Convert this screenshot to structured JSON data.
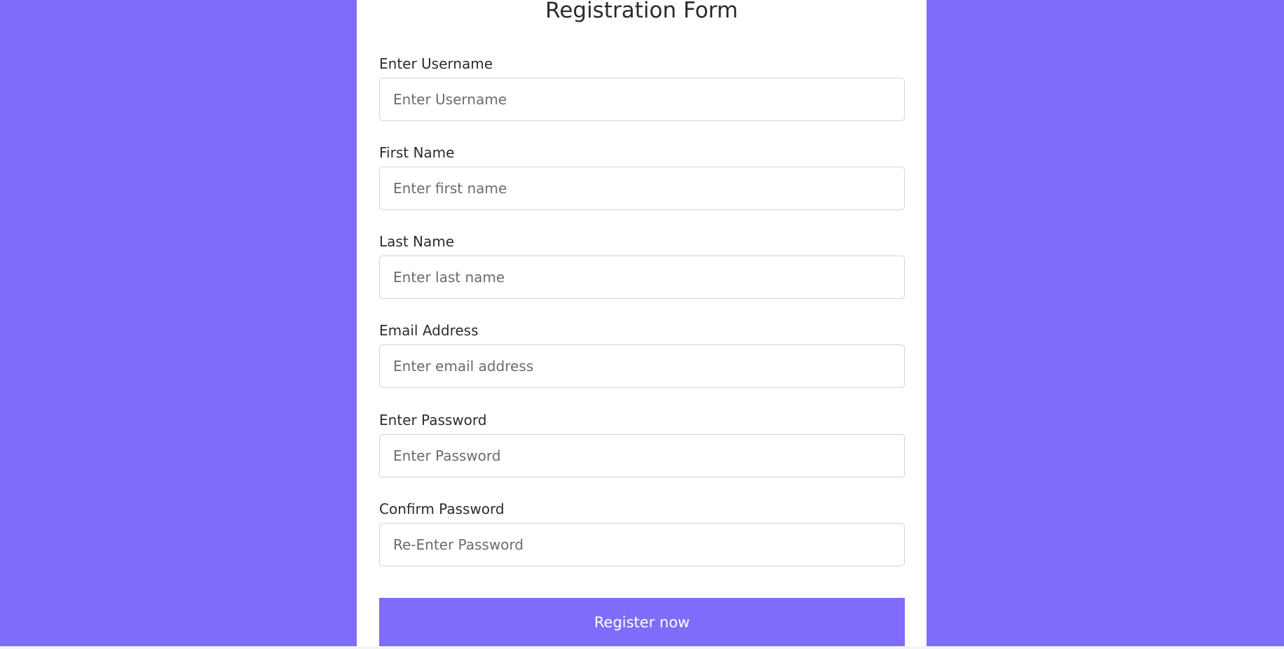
{
  "form": {
    "title": "Registration Form",
    "fields": [
      {
        "label": "Enter Username",
        "placeholder": "Enter Username",
        "value": ""
      },
      {
        "label": "First Name",
        "placeholder": "Enter first name",
        "value": ""
      },
      {
        "label": "Last Name",
        "placeholder": "Enter last name",
        "value": ""
      },
      {
        "label": "Email Address",
        "placeholder": "Enter email address",
        "value": ""
      },
      {
        "label": "Enter Password",
        "placeholder": "Enter Password",
        "value": ""
      },
      {
        "label": "Confirm Password",
        "placeholder": "Re-Enter Password",
        "value": ""
      }
    ],
    "submit_label": "Register now"
  },
  "colors": {
    "background": "#806cfb",
    "card": "#ffffff",
    "button": "#806cfb",
    "button_text": "#ffffff",
    "input_border": "#d3d3d3"
  }
}
